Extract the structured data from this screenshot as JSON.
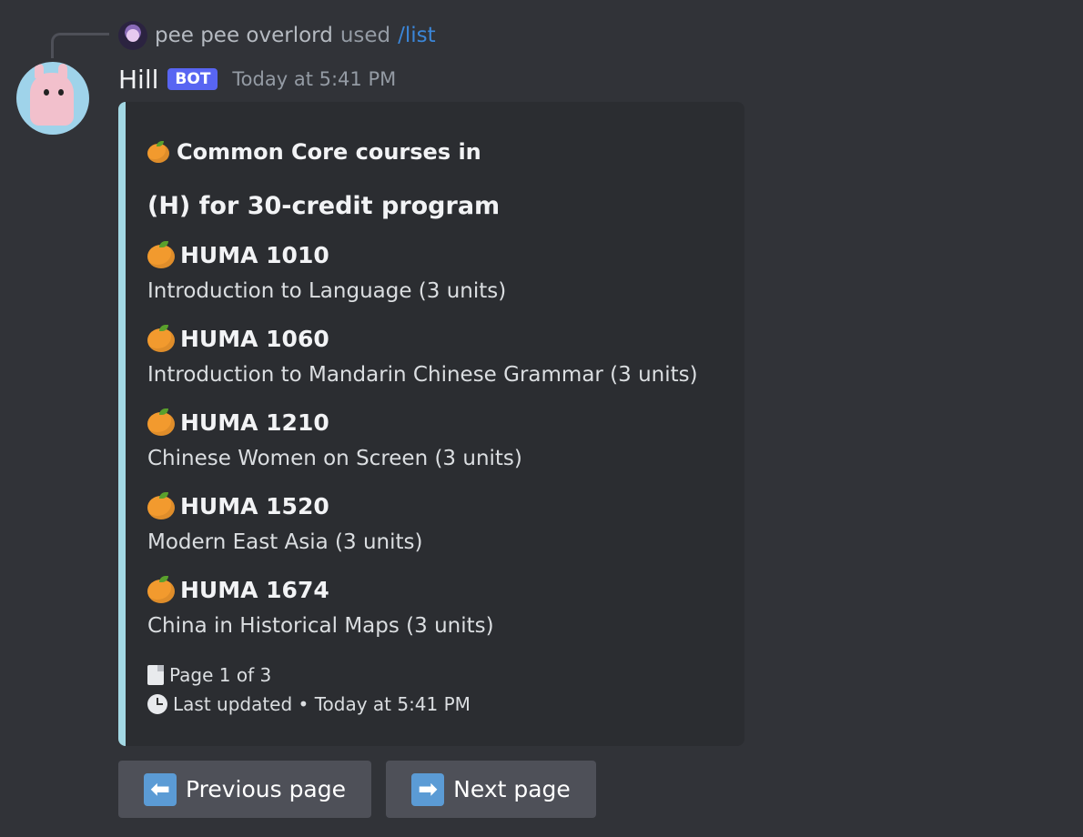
{
  "command": {
    "user": "pee pee overlord",
    "used_text": "used",
    "command_name": "/list"
  },
  "message": {
    "author": "Hill",
    "tag": "BOT",
    "timestamp": "Today at 5:41 PM"
  },
  "embed": {
    "accent_color": "#a3d8e4",
    "title_line1": "Common Core courses in",
    "title_line2": "(H) for 30-credit program",
    "courses": [
      {
        "code": "HUMA 1010",
        "desc": "Introduction to Language (3 units)",
        "icon": "tangerine-icon"
      },
      {
        "code": "HUMA 1060",
        "desc": "Introduction to Mandarin Chinese Grammar (3 units)",
        "icon": "tangerine-icon"
      },
      {
        "code": "HUMA 1210",
        "desc": "Chinese Women on Screen (3 units)",
        "icon": "tangerine-icon"
      },
      {
        "code": "HUMA 1520",
        "desc": "Modern East Asia (3 units)",
        "icon": "tangerine-icon"
      },
      {
        "code": "HUMA 1674",
        "desc": "China in Historical Maps (3 units)",
        "icon": "tangerine-icon"
      }
    ],
    "page_text": "Page 1 of 3",
    "updated_text": "Last updated • Today at 5:41 PM"
  },
  "buttons": {
    "prev_label": "Previous page",
    "next_label": "Next page",
    "prev_icon": "arrow-left-icon",
    "next_icon": "arrow-right-icon",
    "button_color": "#4e5058"
  }
}
